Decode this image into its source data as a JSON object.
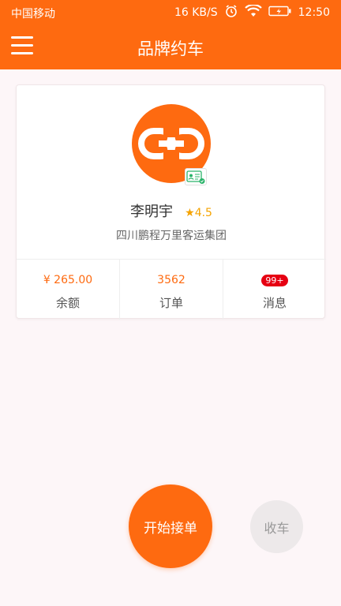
{
  "status_bar": {
    "carrier": "中国移动",
    "speed": "16 KB/S",
    "time": "12:50"
  },
  "app_bar": {
    "title": "品牌约车",
    "menu_icon": "hamburger-menu-icon"
  },
  "driver": {
    "name": "李明宇",
    "rating": "4.5",
    "company": "四川鹏程万里客运集团",
    "avatar_icon": "link-icon",
    "badge_icon": "id-card-verified-icon"
  },
  "stats": {
    "balance_value": "¥ 265.00",
    "balance_label": "余额",
    "orders_value": "3562",
    "orders_label": "订单",
    "messages_badge": "99+",
    "messages_label": "消息"
  },
  "actions": {
    "start_label": "开始接单",
    "stop_label": "收车"
  },
  "colors": {
    "accent": "#fe6a10",
    "rating": "#f5a300",
    "badge_red": "#e60012",
    "background": "#fdf6f8"
  }
}
